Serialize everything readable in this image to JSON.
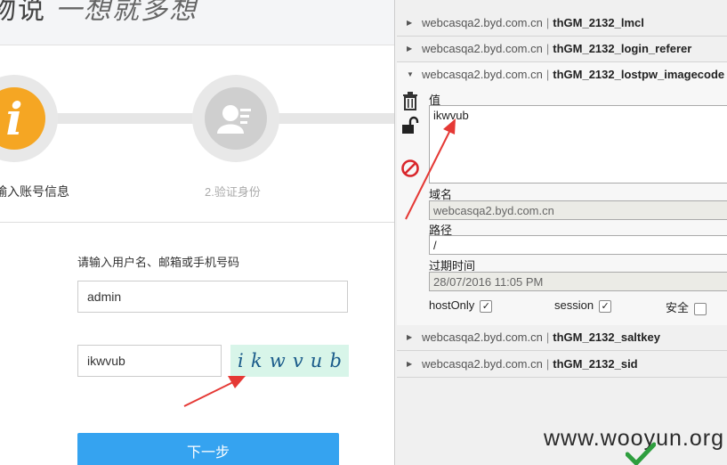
{
  "header": {
    "title": "物说",
    "script": "一想就多想"
  },
  "steps": [
    {
      "icon": "info-icon",
      "glyph": "i",
      "label": "输入账号信息",
      "state": "active"
    },
    {
      "icon": "id-card-icon",
      "label": "2.验证身份",
      "state": "inactive"
    }
  ],
  "form": {
    "hint": "请输入用户名、邮箱或手机号码",
    "username_value": "admin",
    "captcha_value": "ikwvub",
    "captcha_chars": [
      "i",
      "k",
      "w",
      "v",
      "u",
      "b"
    ],
    "next_label": "下一步"
  },
  "cookie_panel": {
    "rows_above": [
      {
        "domain": "webcasqa2.byd.com.cn",
        "name": "thGM_2132_lmcl"
      },
      {
        "domain": "webcasqa2.byd.com.cn",
        "name": "thGM_2132_login_referer"
      }
    ],
    "expanded": {
      "domain": "webcasqa2.byd.com.cn",
      "name": "thGM_2132_lostpw_imagecode",
      "value_label": "值",
      "value": "ikwvub",
      "domain_label": "域名",
      "domain_value": "webcasqa2.byd.com.cn",
      "path_label": "路径",
      "path_value": "/",
      "expires_label": "过期时间",
      "expires_value": "28/07/2016 11:05 PM",
      "hostonly_label": "hostOnly",
      "hostonly_checked": true,
      "session_label": "session",
      "session_checked": true,
      "secure_label": "安全",
      "secure_checked": false
    },
    "rows_below": [
      {
        "domain": "webcasqa2.byd.com.cn",
        "name": "thGM_2132_saltkey"
      },
      {
        "domain": "webcasqa2.byd.com.cn",
        "name": "thGM_2132_sid"
      }
    ],
    "separator": "|"
  },
  "watermark": "www.wooyun.org",
  "colors": {
    "step_active": "#f5a623",
    "button": "#35a3f0",
    "captcha_bg": "#d8f5e9",
    "arrow": "#e53935",
    "check": "#2e9e3e",
    "delete": "#d9262b"
  }
}
